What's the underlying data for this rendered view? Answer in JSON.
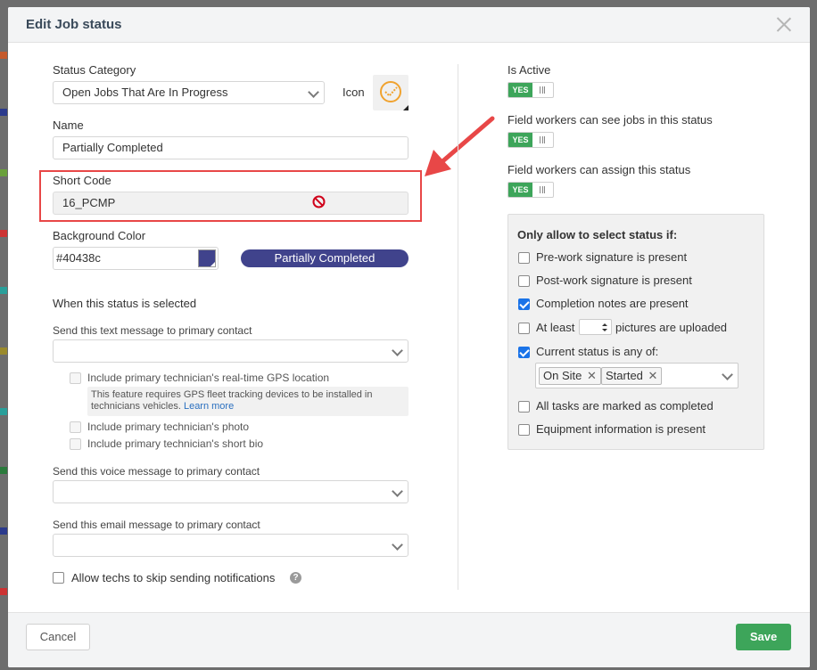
{
  "modal": {
    "title": "Edit Job status"
  },
  "left": {
    "status_category": {
      "label": "Status Category",
      "value": "Open Jobs That Are In Progress"
    },
    "icon_label": "Icon",
    "name": {
      "label": "Name",
      "value": "Partially Completed"
    },
    "short_code": {
      "label": "Short Code",
      "value": "16_PCMP"
    },
    "background_color": {
      "label": "Background Color",
      "value": "#40438c",
      "preview": "Partially Completed"
    },
    "when_selected": "When this status is selected",
    "text_message": {
      "label": "Send this text message to primary contact",
      "value": ""
    },
    "gps_option": "Include primary technician's real-time GPS location",
    "gps_note": "This feature requires GPS fleet tracking devices to be installed in technicians vehicles.",
    "gps_learn_more": "Learn more",
    "photo_option": "Include primary technician's photo",
    "bio_option": "Include primary technician's short bio",
    "voice_message": {
      "label": "Send this voice message to primary contact",
      "value": ""
    },
    "email_message": {
      "label": "Send this email message to primary contact",
      "value": ""
    },
    "skip_notifications": "Allow techs to skip sending notifications"
  },
  "right": {
    "is_active": {
      "label": "Is Active",
      "toggle": "YES"
    },
    "field_see": {
      "label": "Field workers can see jobs in this status",
      "toggle": "YES"
    },
    "field_assign": {
      "label": "Field workers can assign this status",
      "toggle": "YES"
    },
    "conditions": {
      "title": "Only allow to select status if:",
      "pre_work": "Pre-work signature is present",
      "post_work": "Post-work signature is present",
      "completion_notes": "Completion notes are present",
      "at_least": "At least",
      "pictures": "pictures are uploaded",
      "current_status": "Current status is any of:",
      "tags": [
        "On Site",
        "Started"
      ],
      "all_tasks": "All tasks are marked as completed",
      "equipment": "Equipment information is present"
    }
  },
  "footer": {
    "cancel": "Cancel",
    "save": "Save"
  },
  "colors": {
    "status_bg": "#40438c",
    "save_btn": "#3da55a",
    "highlight": "#e84747",
    "toggle_on": "#3da55a",
    "icon_orange": "#f0a22e"
  }
}
